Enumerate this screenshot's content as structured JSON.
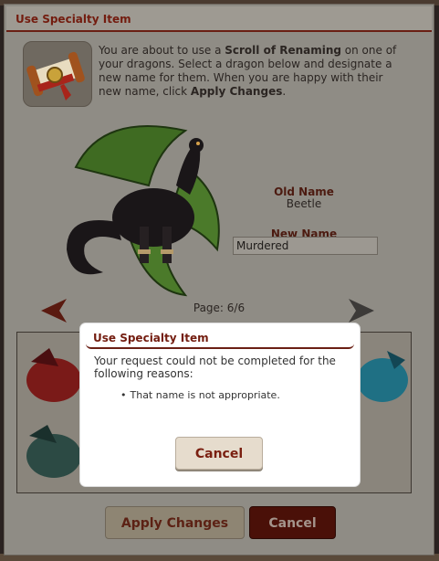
{
  "dialog": {
    "title": "Use Specialty Item",
    "intro_prefix": "You are about to use a ",
    "item_name": "Scroll of Renaming",
    "intro_middle": " on one of your dragons. Select a dragon below and designate a new name for them. When you are happy with their new name, click ",
    "intro_action": "Apply Changes",
    "intro_suffix": "."
  },
  "rename": {
    "old_name_label": "Old Name",
    "old_name_value": "Beetle",
    "new_name_label": "New Name",
    "new_name_value": "Murdered"
  },
  "pagination": {
    "label": "Page: 6/6"
  },
  "buttons": {
    "apply": "Apply Changes",
    "cancel": "Cancel"
  },
  "modal": {
    "title": "Use Specialty Item",
    "message": "Your request could not be completed for the following reasons:",
    "reasons": [
      "That name is not appropriate."
    ],
    "cancel": "Cancel"
  },
  "colors": {
    "accent": "#731c0f",
    "dialog_bg": "#8f8c85",
    "primary_button": "#4a1008",
    "modal_bg": "#ffffff"
  },
  "icons": {
    "item": "scroll-icon",
    "prev": "arrow-left-icon",
    "next": "arrow-right-icon"
  }
}
